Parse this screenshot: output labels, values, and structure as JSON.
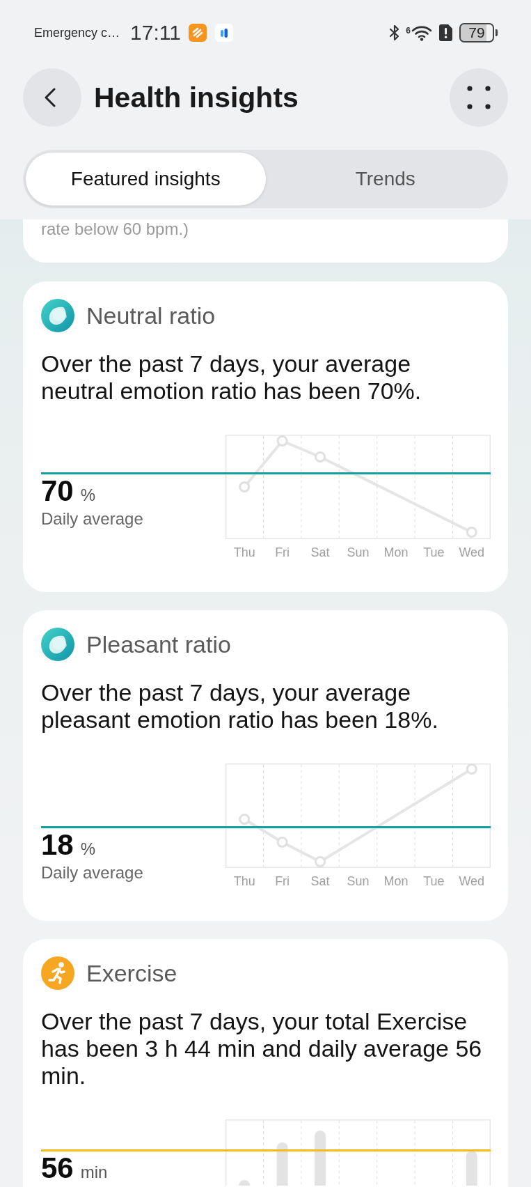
{
  "status_bar": {
    "notice": "Emergency c…",
    "time": "17:11",
    "wifi_generation": "6",
    "battery": "79"
  },
  "header": {
    "title": "Health insights"
  },
  "tabs": [
    {
      "label": "Featured insights",
      "selected": true
    },
    {
      "label": "Trends",
      "selected": false
    }
  ],
  "previous_card": {
    "text": "rate below 60 bpm.)"
  },
  "insights": [
    {
      "kind": "emotion",
      "title": "Neutral ratio",
      "summary": "Over the past 7 days, your average neutral emotion ratio has been 70%.",
      "value": "70",
      "unit": "%",
      "caption": "Daily average",
      "color": "#14a0a0",
      "day_labels": [
        "Thu",
        "Fri",
        "Sat",
        "Sun",
        "Mon",
        "Tue",
        "Wed"
      ]
    },
    {
      "kind": "emotion",
      "title": "Pleasant ratio",
      "summary": "Over the past 7 days, your average pleasant emotion ratio has been 18%.",
      "value": "18",
      "unit": "%",
      "caption": "Daily average",
      "color": "#14a0a0",
      "day_labels": [
        "Thu",
        "Fri",
        "Sat",
        "Sun",
        "Mon",
        "Tue",
        "Wed"
      ]
    },
    {
      "kind": "exercise",
      "title": "Exercise",
      "summary": "Over the past 7 days, your total Exercise has been 3 h 44 min and daily average 56 min.",
      "value": "56",
      "unit": "min",
      "color": "#f4b914"
    }
  ]
}
